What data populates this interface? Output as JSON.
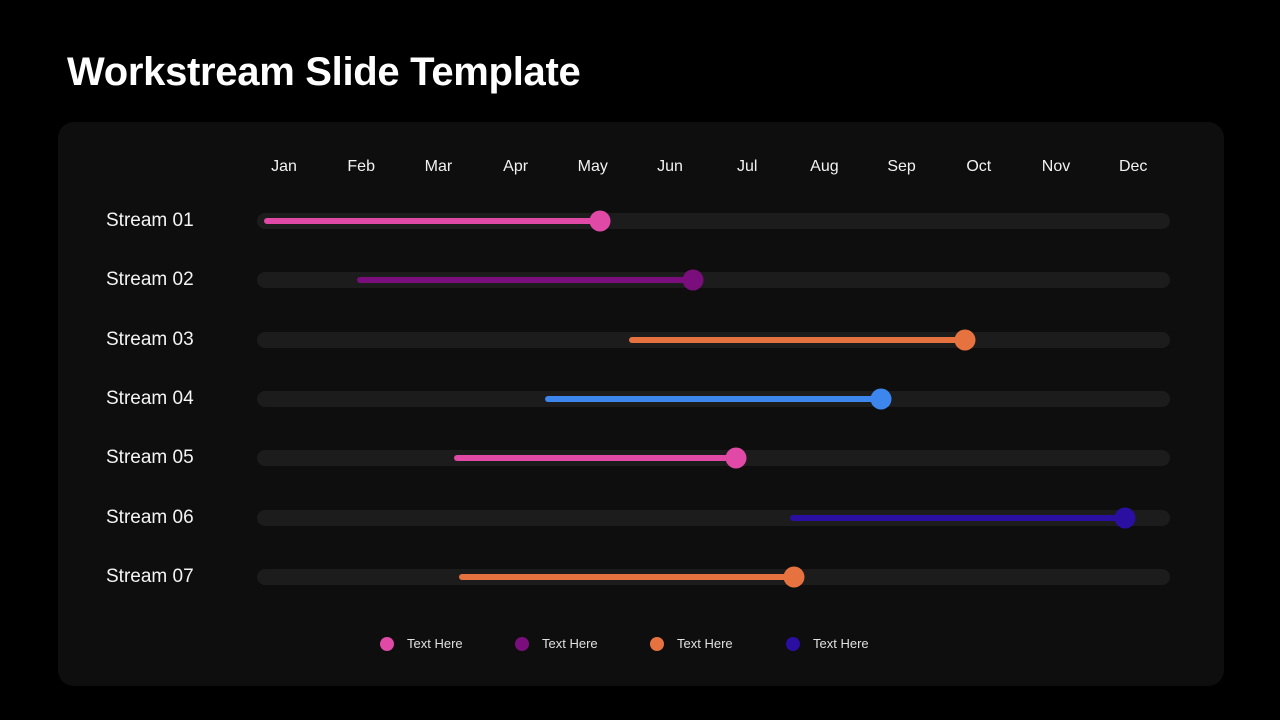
{
  "title": "Workstream Slide Template",
  "chart_data": {
    "type": "gantt",
    "title": "Workstream Slide Template",
    "months": [
      "Jan",
      "Feb",
      "Mar",
      "Apr",
      "May",
      "Jun",
      "Jul",
      "Aug",
      "Sep",
      "Oct",
      "Nov",
      "Dec"
    ],
    "x_range_months": [
      0.65,
      12.5
    ],
    "streams": [
      {
        "label": "Stream 01",
        "start": 0.74,
        "end": 5.09,
        "color": "#e04aa6"
      },
      {
        "label": "Stream 02",
        "start": 1.95,
        "end": 6.3,
        "color": "#7a0e7c"
      },
      {
        "label": "Stream 03",
        "start": 5.47,
        "end": 9.82,
        "color": "#e6733f"
      },
      {
        "label": "Stream 04",
        "start": 4.38,
        "end": 8.73,
        "color": "#3c86ee"
      },
      {
        "label": "Stream 05",
        "start": 3.2,
        "end": 6.85,
        "color": "#e04aa6"
      },
      {
        "label": "Stream 06",
        "start": 7.55,
        "end": 11.9,
        "color": "#2a0fa0"
      },
      {
        "label": "Stream 07",
        "start": 3.27,
        "end": 7.6,
        "color": "#e6733f"
      }
    ],
    "legend": [
      {
        "label": "Text Here",
        "color": "#e04aa6"
      },
      {
        "label": "Text Here",
        "color": "#7a0e7c"
      },
      {
        "label": "Text Here",
        "color": "#e6733f"
      },
      {
        "label": "Text Here",
        "color": "#2a0fa0"
      }
    ],
    "legend_position": "bottom-center"
  }
}
